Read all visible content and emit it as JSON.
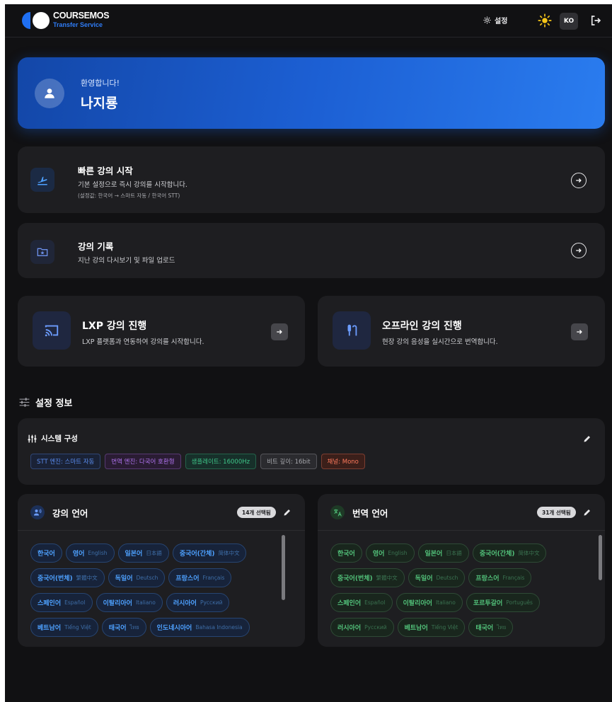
{
  "header": {
    "brand": "COURSEMOS",
    "brand_sub": "Transfer Service",
    "settings_label": "설정",
    "lang_button": "KO"
  },
  "welcome": {
    "greeting": "환영합니다!",
    "name": "나지룡"
  },
  "quick_start": {
    "title": "빠른 강의 시작",
    "desc": "기본 설정으로 즉시 강의를 시작합니다.",
    "sub": "(설정값: 한국어 → 스마트 자동 / 한국어 STT)"
  },
  "history": {
    "title": "강의 기록",
    "desc": "지난 강의 다시보기 및 파일 업로드"
  },
  "lxp": {
    "title": "LXP 강의 진행",
    "desc": "LXP 플랫폼과 연동하여 강의를 시작합니다."
  },
  "offline": {
    "title": "오프라인 강의 진행",
    "desc": "현장 강의 음성을 실시간으로 번역합니다."
  },
  "settings_info": {
    "title": "설정 정보",
    "system_title": "시스템 구성",
    "tags": [
      {
        "label": "STT 엔진: 스마트 자동",
        "color": "#5b8def",
        "bg": "#1a2236"
      },
      {
        "label": "번역 엔진: 다국어 호환형",
        "color": "#b074f0",
        "bg": "#2a1c33"
      },
      {
        "label": "샘플레이트: 16000Hz",
        "color": "#3fc78a",
        "bg": "#17302a"
      },
      {
        "label": "비트 깊이: 16bit",
        "color": "#a7a8ad",
        "bg": "#2b2b2f"
      },
      {
        "label": "채널: Mono",
        "color": "#ff7a5c",
        "bg": "#3b1f1a"
      }
    ]
  },
  "lecture_lang": {
    "title": "강의 언어",
    "badge": "14개 선택됨",
    "items": [
      {
        "k": "한국어",
        "n": ""
      },
      {
        "k": "영어",
        "n": "English"
      },
      {
        "k": "일본어",
        "n": "日本語"
      },
      {
        "k": "중국어(간체)",
        "n": "简体中文"
      },
      {
        "k": "중국어(번체)",
        "n": "繁體中文"
      },
      {
        "k": "독일어",
        "n": "Deutsch"
      },
      {
        "k": "프랑스어",
        "n": "Français"
      },
      {
        "k": "스페인어",
        "n": "Español"
      },
      {
        "k": "이탈리아어",
        "n": "Italiano"
      },
      {
        "k": "러시아어",
        "n": "Русский"
      },
      {
        "k": "베트남어",
        "n": "Tiếng Việt"
      },
      {
        "k": "태국어",
        "n": "ไทย"
      },
      {
        "k": "인도네시아어",
        "n": "Bahasa Indonesia"
      }
    ]
  },
  "trans_lang": {
    "title": "번역 언어",
    "badge": "31개 선택됨",
    "items": [
      {
        "k": "한국어",
        "n": ""
      },
      {
        "k": "영어",
        "n": "English"
      },
      {
        "k": "일본어",
        "n": "日本語"
      },
      {
        "k": "중국어(간체)",
        "n": "简体中文"
      },
      {
        "k": "중국어(번체)",
        "n": "繁體中文"
      },
      {
        "k": "독일어",
        "n": "Deutsch"
      },
      {
        "k": "프랑스어",
        "n": "Français"
      },
      {
        "k": "스페인어",
        "n": "Español"
      },
      {
        "k": "이탈리아어",
        "n": "Italiano"
      },
      {
        "k": "포르투갈어",
        "n": "Português"
      },
      {
        "k": "러시아어",
        "n": "Русский"
      },
      {
        "k": "베트남어",
        "n": "Tiếng Việt"
      },
      {
        "k": "태국어",
        "n": "ไทย"
      }
    ]
  },
  "icons": {
    "logo": "logo-icon",
    "settings": "gear-icon",
    "theme": "sun-icon",
    "logout": "logout-icon",
    "quick_start": "takeoff-icon",
    "history": "folder-star-icon",
    "lxp": "cast-icon",
    "offline": "microphone-icon",
    "settings_info": "sliders-icon",
    "system": "equalizer-icon",
    "lecture_lang": "voice-icon",
    "trans_lang": "translate-icon"
  }
}
